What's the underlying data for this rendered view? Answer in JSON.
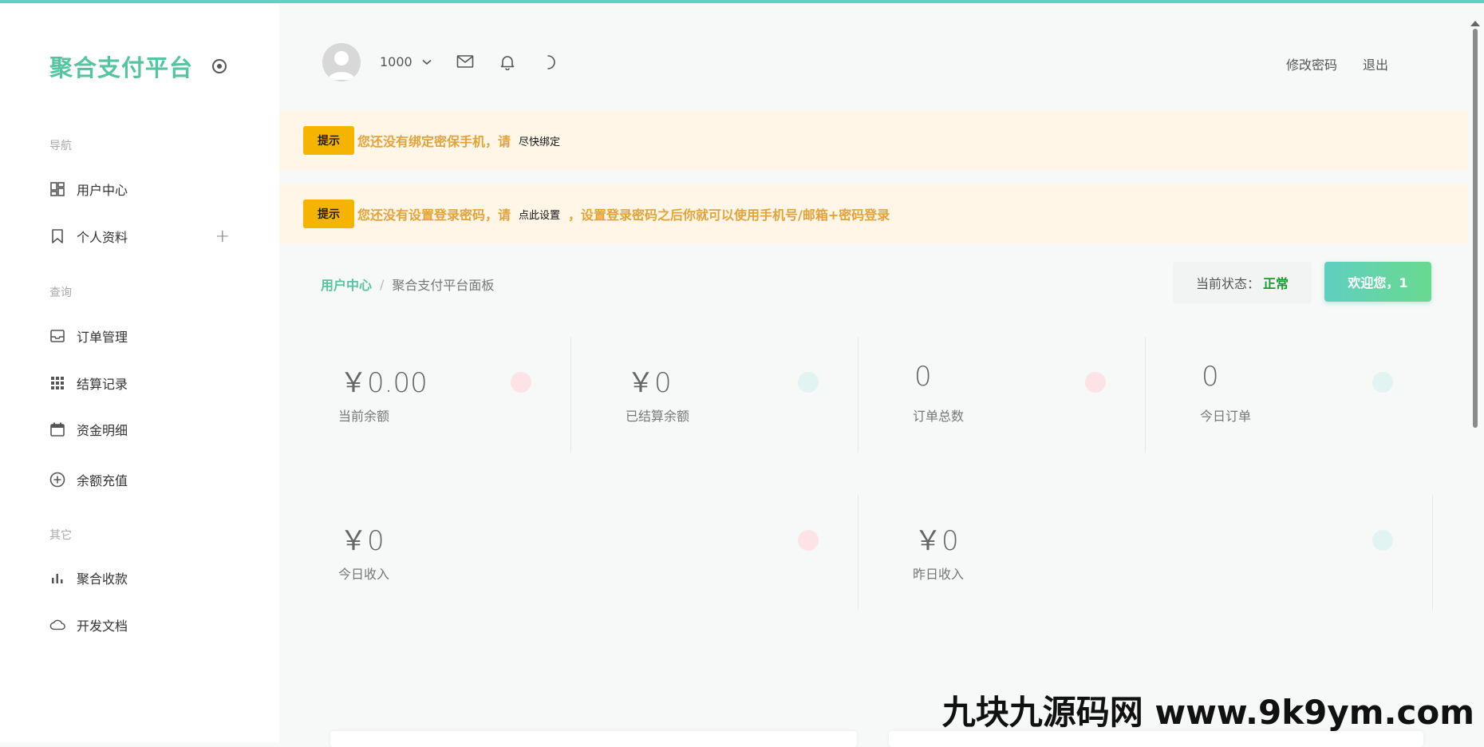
{
  "brand": {
    "title": "聚合支付平台"
  },
  "sidebar": {
    "sections": {
      "nav": "导航",
      "query": "查询",
      "other": "其它"
    },
    "items": [
      {
        "label": "用户中心",
        "icon": "dashboard-icon"
      },
      {
        "label": "个人资料",
        "icon": "bookmark-icon",
        "expand": "+"
      },
      {
        "label": "订单管理",
        "icon": "inbox-icon"
      },
      {
        "label": "结算记录",
        "icon": "grid-icon"
      },
      {
        "label": "资金明细",
        "icon": "calendar-icon"
      },
      {
        "label": "余额充值",
        "icon": "plus-circle-icon"
      },
      {
        "label": "聚合收款",
        "icon": "bar-chart-icon"
      },
      {
        "label": "开发文档",
        "icon": "cloud-icon"
      }
    ]
  },
  "topbar": {
    "user_id": "1000",
    "change_password": "修改密码",
    "logout": "退出"
  },
  "alerts": [
    {
      "tag": "提示",
      "message": "您还没有绑定密保手机，请",
      "link": "尽快绑定",
      "suffix": ""
    },
    {
      "tag": "提示",
      "message": "您还没有设置登录密码，请",
      "link": "点此设置",
      "suffix": "，设置登录密码之后你就可以使用手机号/邮箱+密码登录"
    }
  ],
  "breadcrumb": {
    "first": "用户中心",
    "separator": "/",
    "second": "聚合支付平台面板"
  },
  "status": {
    "label": "当前状态：",
    "value": "正常"
  },
  "welcome": {
    "label": "欢迎您，1"
  },
  "stats": [
    {
      "value": "￥0.00",
      "label": "当前余额",
      "dot_color": "#fde3e6"
    },
    {
      "value": "￥0",
      "label": "已结算余额",
      "dot_color": "#e1f4f1"
    },
    {
      "value": "0",
      "label": "订单总数",
      "dot_color": "#fde3e6"
    },
    {
      "value": "0",
      "label": "今日订单",
      "dot_color": "#e1f4f1"
    },
    {
      "value": "￥0",
      "label": "今日收入",
      "dot_color": "#fde3e6"
    },
    {
      "value": "￥0",
      "label": "昨日收入",
      "dot_color": "#e1f4f1"
    }
  ],
  "watermark": {
    "text": "九块九源码网 www.9k9ym.com"
  },
  "colors": {
    "brand": "#54c5a0",
    "alert_tag": "#f5b400",
    "alert_text": "#e3a33a",
    "status_ok": "#1a9c2a"
  }
}
